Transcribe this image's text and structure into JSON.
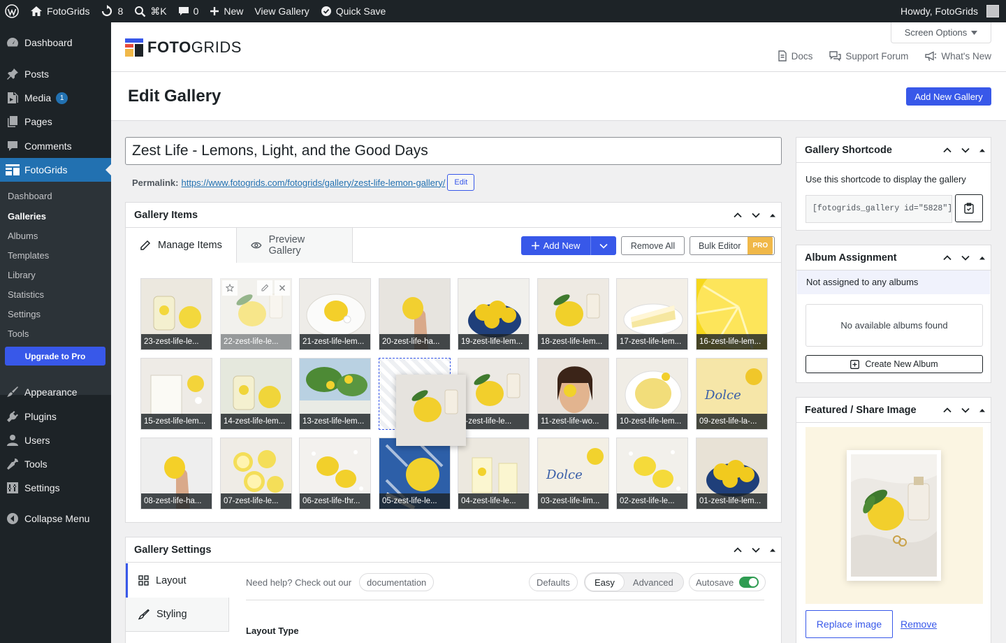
{
  "adminbar": {
    "site_name": "FotoGrids",
    "updates_count": "8",
    "search_shortcut": "⌘K",
    "comments_count": "0",
    "new_label": "New",
    "view_gallery": "View Gallery",
    "quick_save": "Quick Save",
    "howdy": "Howdy, FotoGrids"
  },
  "sidebar": {
    "items": [
      {
        "label": "Dashboard",
        "icon": "dashboard-icon"
      },
      {
        "label": "Posts",
        "icon": "pin-icon"
      },
      {
        "label": "Media",
        "icon": "media-icon",
        "badge": "1"
      },
      {
        "label": "Pages",
        "icon": "pages-icon"
      },
      {
        "label": "Comments",
        "icon": "comments-icon"
      },
      {
        "label": "FotoGrids",
        "icon": "fotogrids-icon"
      }
    ],
    "submenu": [
      "Dashboard",
      "Galleries",
      "Albums",
      "Templates",
      "Library",
      "Statistics",
      "Settings",
      "Tools"
    ],
    "upgrade": "Upgrade to Pro",
    "lower_items": [
      {
        "label": "Appearance",
        "icon": "brush-icon"
      },
      {
        "label": "Plugins",
        "icon": "plugin-icon"
      },
      {
        "label": "Users",
        "icon": "users-icon"
      },
      {
        "label": "Tools",
        "icon": "wrench-icon"
      },
      {
        "label": "Settings",
        "icon": "settings-icon"
      }
    ],
    "collapse": "Collapse Menu"
  },
  "brand": {
    "logo_bold": "FOTO",
    "logo_light": "GRIDS",
    "screen_options": "Screen Options",
    "docs": "Docs",
    "support": "Support Forum",
    "whats_new": "What's New"
  },
  "page": {
    "title": "Edit Gallery",
    "add_new_gallery": "Add New Gallery",
    "gallery_title": "Zest Life - Lemons, Light, and the Good Days",
    "permalink_label": "Permalink:",
    "permalink_url": "https://www.fotogrids.com/fotogrids/gallery/zest-life-lemon-gallery/",
    "permalink_edit": "Edit"
  },
  "gallery_items": {
    "heading": "Gallery Items",
    "tab_manage": "Manage Items",
    "tab_preview": "Preview Gallery",
    "add_new": "Add New",
    "remove_all": "Remove All",
    "bulk_editor": "Bulk Editor",
    "pro_badge": "PRO",
    "items": [
      "23-zest-life-le...",
      "22-zest-life-le...",
      "21-zest-life-lem...",
      "20-zest-life-ha...",
      "19-zest-life-lem...",
      "18-zest-life-lem...",
      "17-zest-life-lem...",
      "16-zest-life-lem...",
      "15-zest-life-lem...",
      "14-zest-life-lem...",
      "13-zest-life-lem...",
      "",
      "2-zest-life-le...",
      "11-zest-life-wo...",
      "10-zest-life-lem...",
      "09-zest-life-la-...",
      "08-zest-life-ha...",
      "07-zest-life-le...",
      "06-zest-life-thr...",
      "05-zest-life-le...",
      "04-zest-life-le...",
      "03-zest-life-lim...",
      "02-zest-life-le...",
      "01-zest-life-lem..."
    ]
  },
  "gallery_settings": {
    "heading": "Gallery Settings",
    "tab_layout": "Layout",
    "tab_styling": "Styling",
    "help_text": "Need help? Check out our",
    "documentation": "documentation",
    "defaults": "Defaults",
    "easy": "Easy",
    "advanced": "Advanced",
    "autosave": "Autosave",
    "layout_type": "Layout Type"
  },
  "shortcode": {
    "heading": "Gallery Shortcode",
    "desc": "Use this shortcode to display the gallery",
    "code": "[fotogrids_gallery id=\"5828\"]"
  },
  "album": {
    "heading": "Album Assignment",
    "notice": "Not assigned to any albums",
    "empty": "No available albums found",
    "create": "Create New Album"
  },
  "featured": {
    "heading": "Featured / Share Image",
    "replace": "Replace image",
    "remove": "Remove"
  },
  "colors": {
    "accent": "#3858e9",
    "wp_blue": "#2271b1",
    "admin_dark": "#1d2327",
    "pro_yellow": "#f0b849"
  }
}
